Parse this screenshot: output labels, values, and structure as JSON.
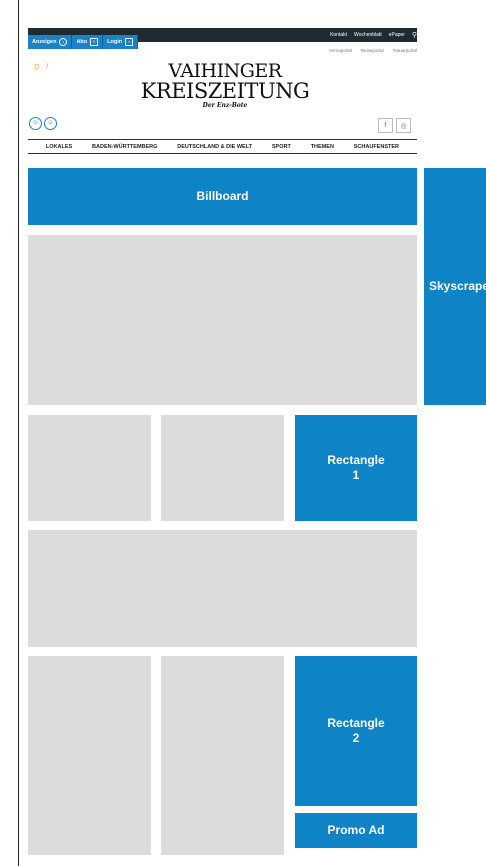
{
  "topbar": {
    "left_buttons": [
      {
        "label": "Anzeigen",
        "icon": "circle-arrow-icon"
      },
      {
        "label": "Abo",
        "icon": "newspaper-icon"
      },
      {
        "label": "Login",
        "icon": "lock-icon"
      }
    ],
    "right_links": [
      "Kontakt",
      "Wochenblatt",
      "ePaper"
    ],
    "search_icon": "search-icon",
    "portals": [
      "Immoportal",
      "Reiseportal",
      "Trauerportal"
    ]
  },
  "weather": {
    "icon": "sun-icon",
    "text": "/"
  },
  "logo": {
    "line1": "VAIHINGER",
    "line2": "KREISZEITUNG",
    "line3": "Der Enz-Bote"
  },
  "nav": [
    "LOKALES",
    "BADEN-WÜRTTEMBERG",
    "DEUTSCHLAND & DIE WELT",
    "SPORT",
    "THEMEN",
    "SCHAUFENSTER"
  ],
  "ads": {
    "billboard": "Billboard",
    "skyscraper": "Skyscraper",
    "rectangle1_line1": "Rectangle",
    "rectangle1_line2": "1",
    "rectangle2_line1": "Rectangle",
    "rectangle2_line2": "2",
    "promo": "Promo Ad"
  },
  "colors": {
    "accent": "#0e83c6",
    "placeholder": "#dcdcdc",
    "topbar": "#1f2a33"
  }
}
